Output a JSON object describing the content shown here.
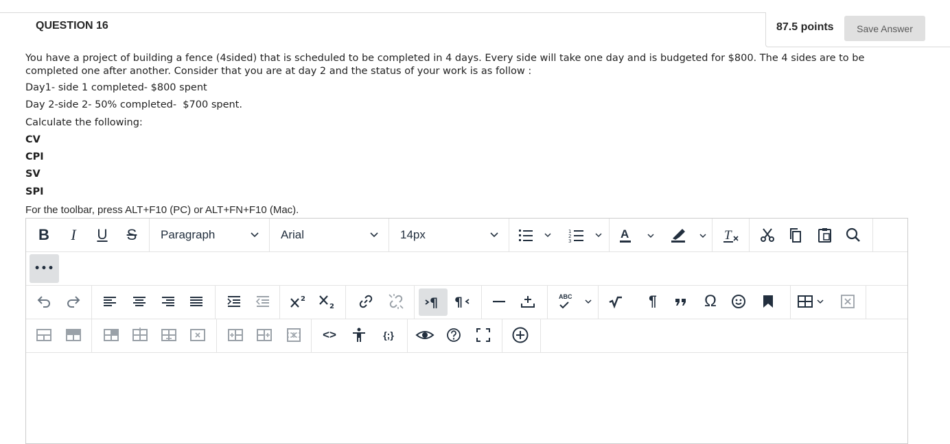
{
  "question": {
    "title": "QUESTION 16",
    "points": "87.5 points",
    "save_label": "Save Answer",
    "intro": "You have a project of building a fence (4sided) that is scheduled to be completed in 4 days. Every side will take one day and is budgeted for $800. The 4 sides are to be completed one after another. Consider that you are at day 2 and the status of your work is as follow :",
    "day1": "Day1- side 1 completed- $800 spent",
    "day2": "Day 2-side 2- 50% completed-  $700 spent.",
    "calc": "Calculate the following:",
    "items": [
      "CV",
      "CPI",
      "SV",
      "SPI"
    ]
  },
  "toolbar_hint": "For the toolbar, press ALT+F10 (PC) or ALT+FN+F10 (Mac).",
  "editor": {
    "format_block": "Paragraph",
    "font_family": "Arial",
    "font_size": "14px",
    "bold_glyph": "B",
    "italic_glyph": "I",
    "underline_glyph": "U",
    "strike_glyph": "S",
    "more_glyph": "•••",
    "source_code_glyph": "<>",
    "code_glyph": "{;}",
    "spellcheck_glyph": "ABC",
    "pilcrow_glyph": "¶",
    "omega_glyph": "Ω"
  },
  "colors": {
    "accent": "#222f3e",
    "border": "#cccccc",
    "active_bg": "#dee0e2"
  }
}
